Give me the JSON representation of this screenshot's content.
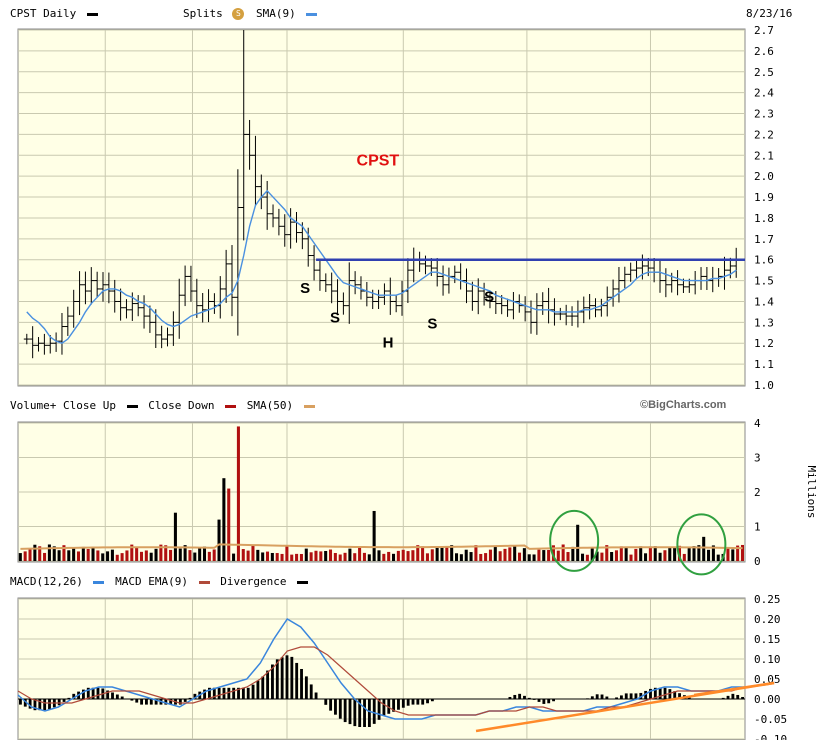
{
  "header": {
    "symbol_label": "CPST Daily",
    "splits_label": "Splits",
    "splits_icon": "s-badge-icon",
    "sma_label": "SMA(9)",
    "date": "8/23/16"
  },
  "volume_header": {
    "label": "Volume+",
    "close_up": "Close Up",
    "close_down": "Close Down",
    "sma": "SMA(50)",
    "watermark": "©BigCharts.com"
  },
  "macd_header": {
    "macd": "MACD(12,26)",
    "ema": "MACD EMA(9)",
    "divergence": "Divergence"
  },
  "colors": {
    "background": "#ffffe6",
    "grid": "#c9c9b0",
    "sma_line": "#4a90e0",
    "resistance": "#3040b0",
    "title_red": "#e01010",
    "up_bar": "#000000",
    "down_bar": "#b01010",
    "vol_sma": "#d8a060",
    "macd_line": "#3a86dd",
    "ema_line": "#b04a3a",
    "circle": "#30a040",
    "trend": "#ff8a2a"
  },
  "chart_data": [
    {
      "type": "ohlc",
      "title": "CPST",
      "y_axis": {
        "min": 1.0,
        "max": 2.7,
        "ticks": [
          "1.0",
          "1.1",
          "1.2",
          "1.3",
          "1.4",
          "1.5",
          "1.6",
          "1.7",
          "1.8",
          "1.9",
          "2.0",
          "2.1",
          "2.2",
          "2.3",
          "2.4",
          "2.5",
          "2.6",
          "2.7"
        ]
      },
      "resistance_level": 1.6,
      "annotations": [
        {
          "text": "S",
          "x": 0.395,
          "y": 1.44
        },
        {
          "text": "S",
          "x": 0.436,
          "y": 1.3
        },
        {
          "text": "H",
          "x": 0.509,
          "y": 1.18
        },
        {
          "text": "S",
          "x": 0.57,
          "y": 1.27
        },
        {
          "text": "S",
          "x": 0.648,
          "y": 1.4
        }
      ],
      "title_pos": {
        "x": 0.495,
        "y": 2.05
      },
      "close_series": [
        1.22,
        1.19,
        1.2,
        1.19,
        1.2,
        1.21,
        1.28,
        1.33,
        1.4,
        1.48,
        1.45,
        1.5,
        1.46,
        1.48,
        1.45,
        1.4,
        1.37,
        1.36,
        1.39,
        1.37,
        1.33,
        1.3,
        1.24,
        1.22,
        1.24,
        1.3,
        1.43,
        1.52,
        1.45,
        1.38,
        1.36,
        1.4,
        1.38,
        1.46,
        1.58,
        1.42,
        1.85,
        2.2,
        2.1,
        1.95,
        1.9,
        1.82,
        1.8,
        1.76,
        1.72,
        1.78,
        1.73,
        1.7,
        1.62,
        1.55,
        1.5,
        1.48,
        1.45,
        1.4,
        1.38,
        1.5,
        1.48,
        1.45,
        1.42,
        1.4,
        1.42,
        1.45,
        1.4,
        1.38,
        1.45,
        1.55,
        1.6,
        1.58,
        1.57,
        1.56,
        1.52,
        1.48,
        1.52,
        1.54,
        1.5,
        1.45,
        1.4,
        1.45,
        1.42,
        1.4,
        1.39,
        1.38,
        1.36,
        1.4,
        1.38,
        1.35,
        1.3,
        1.38,
        1.4,
        1.36,
        1.34,
        1.34,
        1.33,
        1.33,
        1.35,
        1.37,
        1.38,
        1.36,
        1.38,
        1.42,
        1.46,
        1.5,
        1.53,
        1.55,
        1.56,
        1.57,
        1.56,
        1.54,
        1.5,
        1.48,
        1.5,
        1.48,
        1.47,
        1.48,
        1.5,
        1.52,
        1.5,
        1.51,
        1.52,
        1.55,
        1.57,
        1.6
      ],
      "sma_series": [
        1.35,
        1.32,
        1.3,
        1.27,
        1.23,
        1.21,
        1.2,
        1.22,
        1.26,
        1.3,
        1.35,
        1.39,
        1.42,
        1.45,
        1.46,
        1.46,
        1.45,
        1.43,
        1.42,
        1.4,
        1.39,
        1.37,
        1.34,
        1.31,
        1.29,
        1.28,
        1.29,
        1.31,
        1.33,
        1.34,
        1.35,
        1.36,
        1.37,
        1.39,
        1.42,
        1.44,
        1.5,
        1.62,
        1.76,
        1.86,
        1.9,
        1.93,
        1.9,
        1.87,
        1.84,
        1.8,
        1.78,
        1.76,
        1.72,
        1.68,
        1.64,
        1.6,
        1.56,
        1.52,
        1.49,
        1.48,
        1.47,
        1.46,
        1.45,
        1.44,
        1.43,
        1.43,
        1.43,
        1.43,
        1.44,
        1.46,
        1.48,
        1.5,
        1.52,
        1.54,
        1.54,
        1.53,
        1.52,
        1.51,
        1.5,
        1.49,
        1.48,
        1.47,
        1.46,
        1.45,
        1.43,
        1.42,
        1.41,
        1.4,
        1.39,
        1.38,
        1.37,
        1.36,
        1.36,
        1.36,
        1.35,
        1.35,
        1.35,
        1.35,
        1.35,
        1.36,
        1.36,
        1.37,
        1.38,
        1.4,
        1.42,
        1.44,
        1.46,
        1.48,
        1.51,
        1.53,
        1.54,
        1.54,
        1.54,
        1.53,
        1.52,
        1.51,
        1.5,
        1.5,
        1.5,
        1.5,
        1.5,
        1.51,
        1.51,
        1.52,
        1.53,
        1.55
      ]
    },
    {
      "type": "bar",
      "y_axis": {
        "min": 0,
        "max": 4,
        "ticks": [
          "0",
          "1",
          "2",
          "3",
          "4"
        ],
        "unit_label": "Millions"
      },
      "spikes": [
        {
          "pos": 0.306,
          "value": 3.9,
          "up": false
        },
        {
          "pos": 0.285,
          "value": 2.4,
          "up": true
        },
        {
          "pos": 0.293,
          "value": 2.1,
          "up": false
        },
        {
          "pos": 0.215,
          "value": 1.4,
          "up": true
        },
        {
          "pos": 0.276,
          "value": 1.2,
          "up": true
        },
        {
          "pos": 0.492,
          "value": 1.45,
          "up": true
        },
        {
          "pos": 0.77,
          "value": 1.05,
          "up": true
        },
        {
          "pos": 0.944,
          "value": 0.7,
          "up": true
        }
      ],
      "base_sma": 0.35,
      "circles": [
        {
          "pos": 0.765,
          "value": 0.35
        },
        {
          "pos": 0.94,
          "value": 0.25
        }
      ]
    },
    {
      "type": "line",
      "y_axis": {
        "min": -0.1,
        "max": 0.25,
        "ticks": [
          "0.25",
          "0.20",
          "0.15",
          "0.10",
          "0.05",
          "0.00",
          "-0.05",
          "-0.10"
        ]
      },
      "macd_series": [
        0.01,
        -0.02,
        -0.03,
        -0.02,
        0.0,
        0.02,
        0.03,
        0.03,
        0.02,
        0.01,
        0.0,
        -0.01,
        -0.02,
        0.0,
        0.02,
        0.03,
        0.04,
        0.05,
        0.09,
        0.15,
        0.2,
        0.18,
        0.14,
        0.09,
        0.04,
        0.0,
        -0.03,
        -0.04,
        -0.05,
        -0.05,
        -0.05,
        -0.04,
        -0.04,
        -0.04,
        -0.04,
        -0.03,
        -0.03,
        -0.02,
        -0.02,
        -0.03,
        -0.03,
        -0.03,
        -0.03,
        -0.02,
        -0.02,
        -0.01,
        0.0,
        0.02,
        0.03,
        0.03,
        0.02,
        0.02,
        0.02,
        0.03,
        0.03
      ],
      "ema_series": [
        0.02,
        0.0,
        -0.01,
        -0.01,
        -0.01,
        0.0,
        0.01,
        0.02,
        0.02,
        0.02,
        0.01,
        0.0,
        -0.01,
        -0.01,
        0.0,
        0.01,
        0.02,
        0.03,
        0.05,
        0.08,
        0.12,
        0.13,
        0.13,
        0.11,
        0.08,
        0.05,
        0.02,
        -0.01,
        -0.03,
        -0.04,
        -0.04,
        -0.04,
        -0.04,
        -0.04,
        -0.04,
        -0.03,
        -0.03,
        -0.03,
        -0.02,
        -0.02,
        -0.03,
        -0.03,
        -0.03,
        -0.03,
        -0.02,
        -0.02,
        -0.01,
        0.0,
        0.01,
        0.02,
        0.02,
        0.02,
        0.02,
        0.02,
        0.03
      ],
      "trend_lines": [
        {
          "from": {
            "pos": 0.63,
            "value": -0.08
          },
          "to": {
            "pos": 1.04,
            "value": 0.04
          }
        },
        {
          "from": {
            "pos": 0.93,
            "value": 0.01
          },
          "to": {
            "pos": 1.04,
            "value": 0.04
          }
        }
      ]
    }
  ]
}
